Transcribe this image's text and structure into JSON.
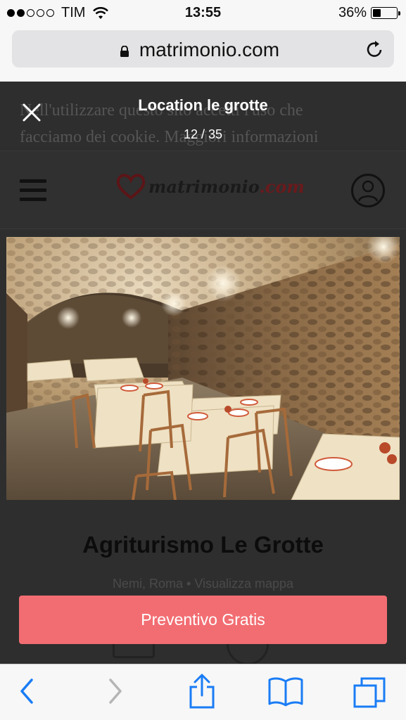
{
  "status_bar": {
    "carrier": "TIM",
    "time": "13:55",
    "battery_percent": "36%",
    "battery_level": 0.36,
    "signal_bars": 2
  },
  "browser": {
    "url": "matrimonio.com"
  },
  "background_page": {
    "cookie_text_line1": "Nell'utilizzare questo sito accetti l'uso che",
    "cookie_text_line2": "facciamo dei cookie. Maggiori informazioni",
    "logo_text": "matrimonio",
    "logo_suffix": ".com",
    "venue_title": "Agriturismo Le Grotte",
    "venue_location": "Nemi, Roma",
    "venue_separator": "•",
    "venue_map_link": "Visualizza mappa"
  },
  "gallery": {
    "title": "Location le grotte",
    "counter": "12 / 35"
  },
  "cta": {
    "label": "Preventivo Gratis",
    "color": "#f26d72"
  },
  "toolbar": {
    "items": [
      "back-icon",
      "forward-icon",
      "share-icon",
      "bookmarks-icon",
      "tabs-icon"
    ],
    "accent": "#1a7cf5"
  }
}
